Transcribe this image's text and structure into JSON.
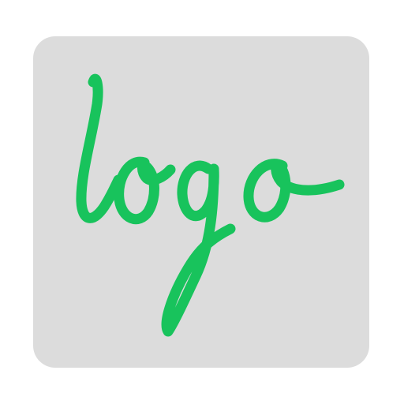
{
  "logo": {
    "text": "logo",
    "accent_color": "#18c35c",
    "tile_color": "#dcdcdc"
  }
}
